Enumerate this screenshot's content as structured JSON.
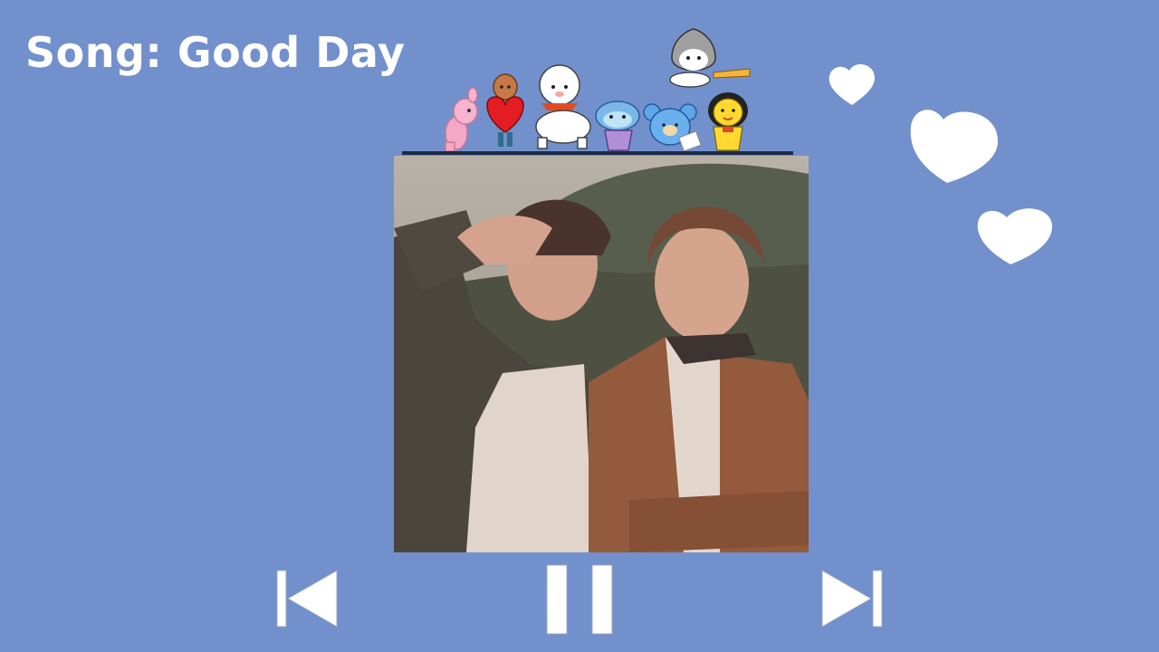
{
  "player": {
    "song_label": "Song: Good Day",
    "state": "playing"
  },
  "controls": {
    "previous": "previous-track",
    "pause": "pause",
    "next": "next-track"
  },
  "icons": {
    "characters": [
      "cooky",
      "shooky",
      "rj",
      "mang",
      "koya",
      "chimmy",
      "van"
    ],
    "decorations": [
      "heart",
      "heart",
      "heart"
    ]
  },
  "colors": {
    "background": "#7290cc",
    "control_fill": "#ffffff",
    "text": "#ffffff"
  }
}
